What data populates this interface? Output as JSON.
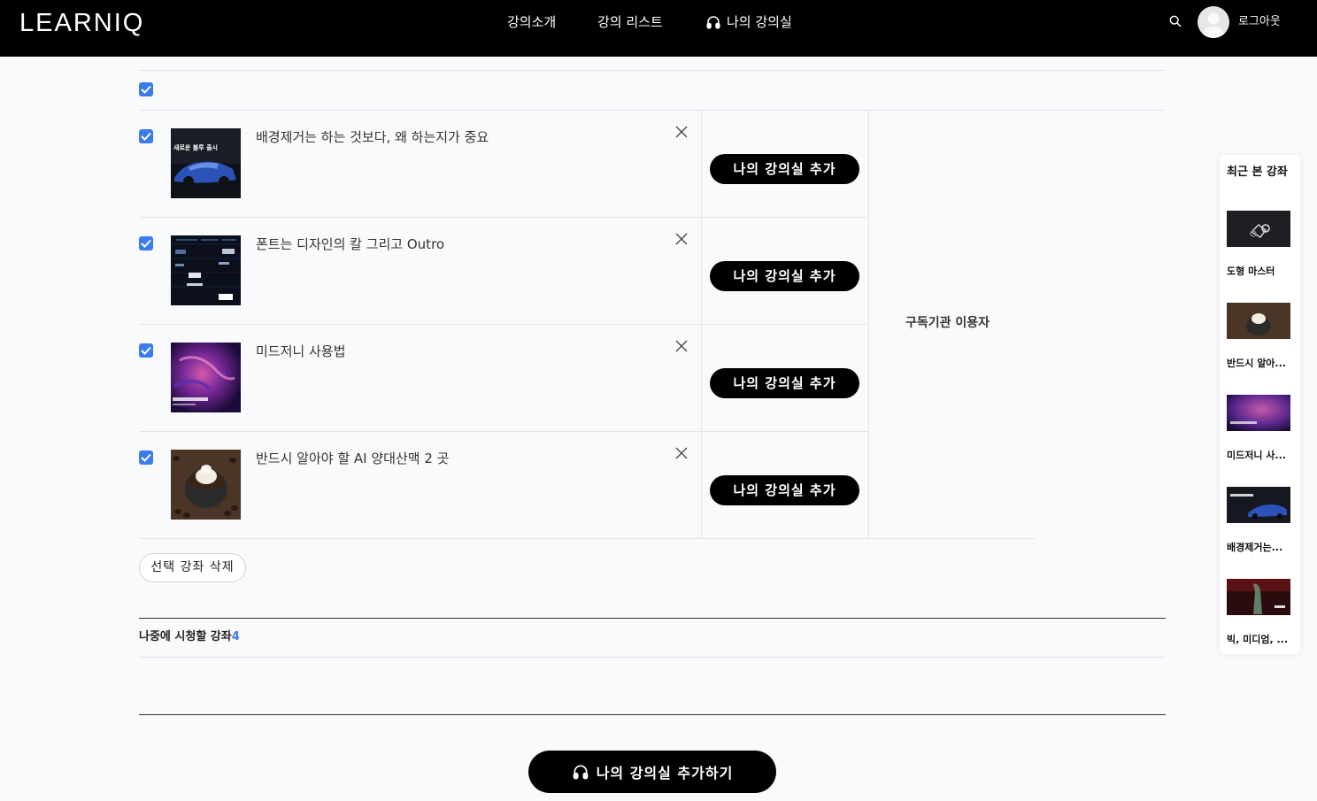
{
  "header": {
    "logo": "LEARNIQ",
    "nav": {
      "intro": "강의소개",
      "list": "강의 리스트",
      "my_classroom": "나의 강의실"
    },
    "logout": "로그아웃"
  },
  "courses": [
    {
      "title": "배경제거는 하는 것보다, 왜 하는지가 중요",
      "add_label": "나의 강의실 추가",
      "thumb_text": "새로운 블루 출시"
    },
    {
      "title": "폰트는 디자인의 칼 그리고 Outro",
      "add_label": "나의 강의실 추가",
      "thumb_text": ""
    },
    {
      "title": "미드저니 사용법",
      "add_label": "나의 강의실 추가",
      "thumb_text": ""
    },
    {
      "title": "반드시 알아야 할 AI 양대산맥 2 곳",
      "add_label": "나의 강의실 추가",
      "thumb_text": ""
    }
  ],
  "subscriber_label": "구독기관 이용자",
  "delete_selected": "선택 강좌 삭제",
  "watch_later": {
    "title": "나중에 시청할 강좌",
    "count": "4"
  },
  "add_all_button": "나의 강의실 추가하기",
  "recent": {
    "title": "최근 본 강좌",
    "items": [
      {
        "label": "도형 마스터"
      },
      {
        "label": "반드시 알아..."
      },
      {
        "label": "미드저니 사..."
      },
      {
        "label": "배경제거는..."
      },
      {
        "label": "빅, 미디엄, ..."
      }
    ]
  },
  "colors": {
    "accent": "#3b7bf0",
    "header_bg": "#000000",
    "page_bg": "#f9fafc"
  }
}
